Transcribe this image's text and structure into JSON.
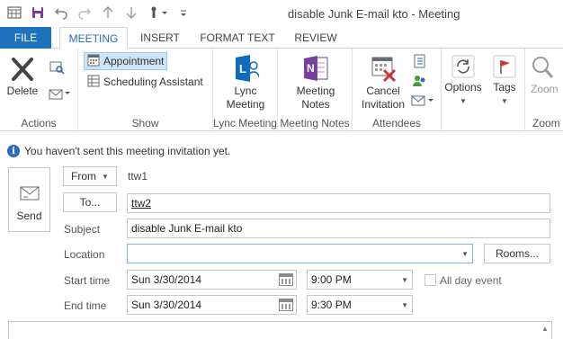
{
  "window": {
    "title": "disable Junk E-mail  kto - Meeting"
  },
  "quick_access": {
    "icons": [
      "outlook-icon",
      "save-icon",
      "undo-icon",
      "redo-icon",
      "up-arrow-icon",
      "down-arrow-icon",
      "touch-mode-icon",
      "customize-icon"
    ]
  },
  "tabs": [
    {
      "label": "FILE"
    },
    {
      "label": "MEETING"
    },
    {
      "label": "INSERT"
    },
    {
      "label": "FORMAT TEXT"
    },
    {
      "label": "REVIEW"
    }
  ],
  "ribbon": {
    "actions": {
      "label": "Actions",
      "delete_label": "Delete"
    },
    "show": {
      "label": "Show",
      "appointment_label": "Appointment",
      "scheduling_label": "Scheduling Assistant"
    },
    "lync": {
      "label": "Lync Meeting",
      "button_line1": "Lync",
      "button_line2": "Meeting"
    },
    "meeting_notes": {
      "label": "Meeting Notes",
      "button_line1": "Meeting",
      "button_line2": "Notes"
    },
    "attendees": {
      "label": "Attendees",
      "button_line1": "Cancel",
      "button_line2": "Invitation"
    },
    "options": {
      "label": "Options"
    },
    "tags": {
      "label": "Tags"
    },
    "zoom": {
      "label": "Zoom"
    }
  },
  "infobar": {
    "text": "You haven't sent this meeting invitation yet."
  },
  "form": {
    "send_label": "Send",
    "from_label": "From",
    "from_value": "ttw1",
    "to_label": "To...",
    "to_value": "ttw2",
    "subject_label": "Subject",
    "subject_value": "disable Junk E-mail  kto",
    "location_label": "Location",
    "location_value": "",
    "rooms_label": "Rooms...",
    "start_label": "Start time",
    "start_date": "Sun 3/30/2014",
    "start_time": "9:00 PM",
    "end_label": "End time",
    "end_date": "Sun 3/30/2014",
    "end_time": "9:30 PM",
    "all_day_label": "All day event",
    "all_day_checked": false
  },
  "colors": {
    "accent": "#1e73be",
    "tab_active_text": "#2a6ac0",
    "onenote_purple": "#7b3f9e",
    "lync_blue": "#0f6cbd",
    "tag_red": "#d13438",
    "cancel_red": "#d13438"
  }
}
